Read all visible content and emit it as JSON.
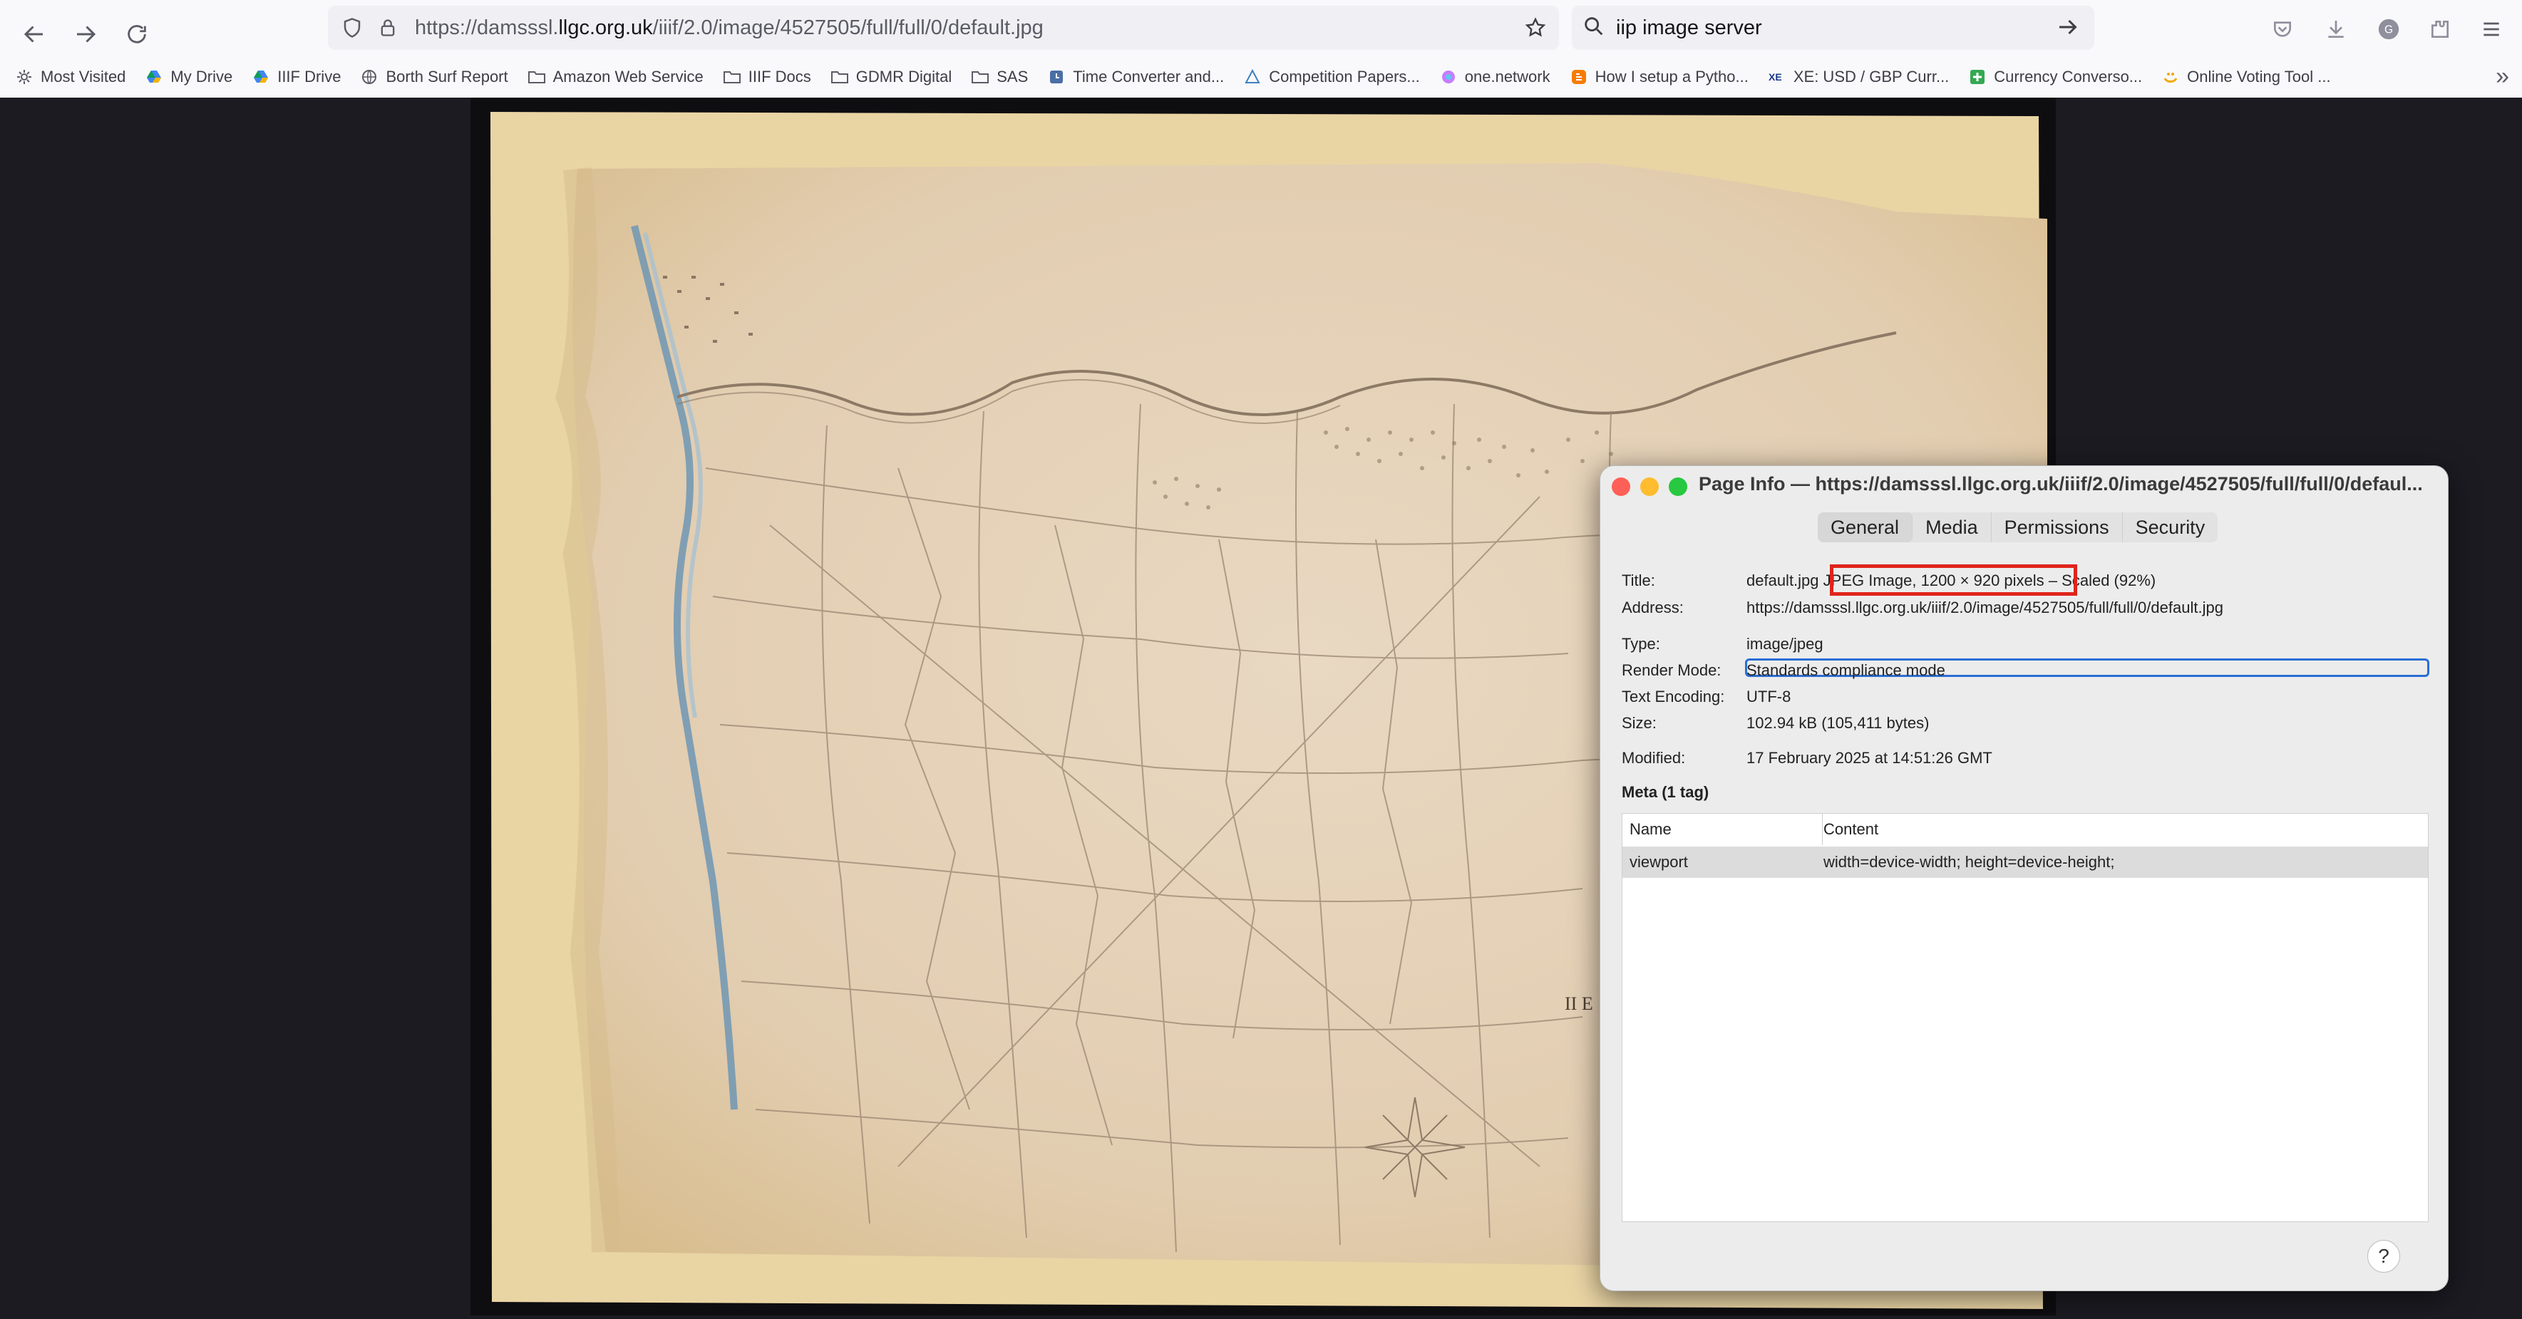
{
  "browser": {
    "url_prefix": "https://damsssl.",
    "url_domain": "llgc.org.uk",
    "url_path": "/iiif/2.0/image/4527505/full/full/0/default.jpg",
    "search_value": "iip image server"
  },
  "bookmarks": [
    {
      "label": "Most Visited",
      "icon": "gear-icon"
    },
    {
      "label": "My Drive",
      "icon": "drive-icon"
    },
    {
      "label": "IIIF Drive",
      "icon": "drive-icon"
    },
    {
      "label": "Borth Surf Report",
      "icon": "globe-icon"
    },
    {
      "label": "Amazon Web Service",
      "icon": "folder-icon"
    },
    {
      "label": "IIIF Docs",
      "icon": "folder-icon"
    },
    {
      "label": "GDMR Digital",
      "icon": "folder-icon"
    },
    {
      "label": "SAS",
      "icon": "folder-icon"
    },
    {
      "label": "Time Converter and...",
      "icon": "clock-icon"
    },
    {
      "label": "Competition Papers...",
      "icon": "triangle-icon"
    },
    {
      "label": "one.network",
      "icon": "network-icon"
    },
    {
      "label": "How I setup a Pytho...",
      "icon": "blogger-icon"
    },
    {
      "label": "XE: USD / GBP Curr...",
      "icon": "xe-icon"
    },
    {
      "label": "Currency Converso...",
      "icon": "plus-icon"
    },
    {
      "label": "Online Voting Tool ...",
      "icon": "vote-icon"
    }
  ],
  "dialog": {
    "title": "Page Info — https://damsssl.llgc.org.uk/iiif/2.0/image/4527505/full/full/0/defaul...",
    "tabs": [
      "General",
      "Media",
      "Permissions",
      "Security"
    ],
    "selected_tab": "General",
    "title_label": "Title:",
    "title_value_a": "default.jpg",
    "title_value_b": "JPEG Image, 1200 × 920 pixels",
    "title_value_c": "– Scaled (92%)",
    "address_label": "Address:",
    "address_value": "https://damsssl.llgc.org.uk/iiif/2.0/image/4527505/full/full/0/default.jpg",
    "type_label": "Type:",
    "type_value": "image/jpeg",
    "render_label": "Render Mode:",
    "render_value": "Standards compliance mode",
    "encoding_label": "Text Encoding:",
    "encoding_value": "UTF-8",
    "size_label": "Size:",
    "size_value": "102.94 kB (105,411 bytes)",
    "modified_label": "Modified:",
    "modified_value": "17 February 2025 at 14:51:26 GMT",
    "meta_heading": "Meta (1 tag)",
    "meta_columns": [
      "Name",
      "Content"
    ],
    "meta_rows": [
      {
        "name": "viewport",
        "content": "width=device-width; height=device-height;"
      }
    ],
    "help_label": "?"
  },
  "map": {
    "label": "II E"
  },
  "colors": {
    "highlight": "#e0241b",
    "focus": "#2a6ed4",
    "paper": "#e6d2b0",
    "coast": "#6f97b4"
  }
}
